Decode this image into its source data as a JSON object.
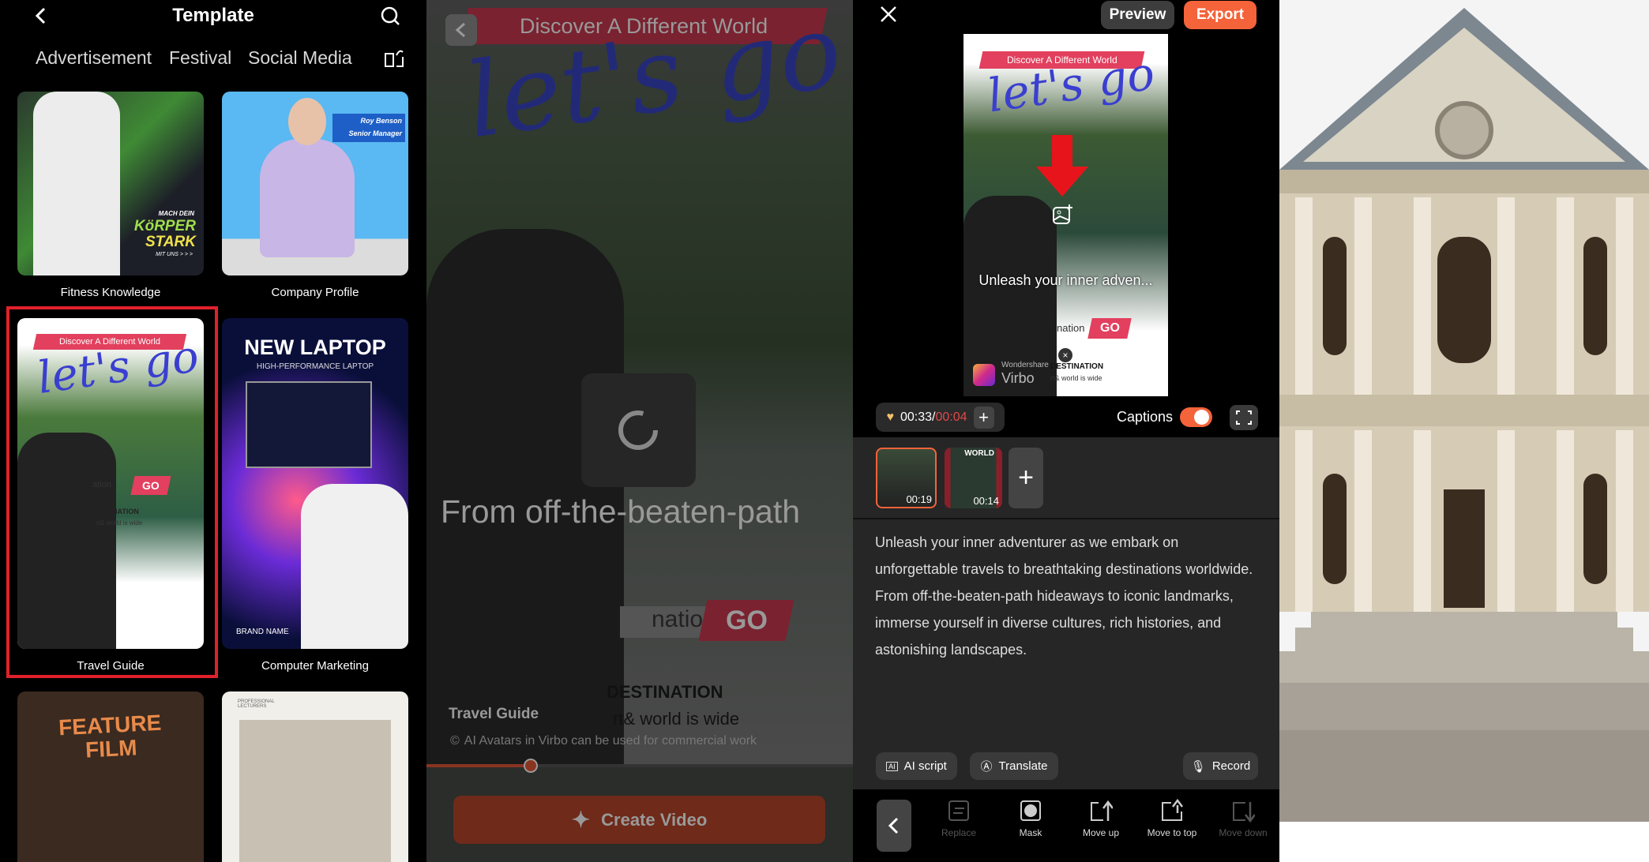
{
  "template_panel": {
    "title": "Template",
    "tabs": [
      "Advertisement",
      "Festival",
      "Social Media"
    ],
    "cards": [
      {
        "label": "Fitness Knowledge",
        "overlay": [
          "MACH DEIN",
          "KöRPER",
          "STARK",
          "MIT UNS > > >"
        ]
      },
      {
        "label": "Company Profile",
        "overlay": [
          "Roy Benson",
          "Senior Manager"
        ]
      },
      {
        "label": "Travel Guide",
        "overlay": [
          "Discover A Different World",
          "let's go",
          "ation",
          "GO",
          "ESTINATION",
          "rt& world is wide"
        ],
        "selected": true
      },
      {
        "label": "Computer Marketing",
        "overlay": [
          "NEW LAPTOP",
          "HIGH-PERFORMANCE LAPTOP",
          "BRAND NAME"
        ]
      },
      {
        "label": "",
        "overlay": [
          "FEATURE",
          "FILM"
        ]
      },
      {
        "label": "",
        "overlay": [
          "PROFESSIONAL LECTURERS"
        ]
      }
    ],
    "selection_color": "#e0212b"
  },
  "preview_panel": {
    "banner": "Discover A Different World",
    "script_title": "let's go",
    "subtitle": "From off-the-beaten-path",
    "cta_left": "nation",
    "cta_right": "GO",
    "destination": "DESTINATION",
    "tagline": "rt& world is wide",
    "template_name": "Travel Guide",
    "notice": "AI Avatars in Virbo can be used for commercial work",
    "progress_percent": 24,
    "create_button": "Create Video"
  },
  "editor_panel": {
    "preview_button": "Preview",
    "export_button": "Export",
    "accent": "#f4633a",
    "canvas": {
      "banner": "Discover A Different World",
      "script_title": "let's go",
      "caption": "Unleash your inner adven...",
      "cta_left": "nation",
      "cta_right": "GO",
      "destination": "DESTINATION",
      "tagline": "rt& world is wide",
      "watermark_brand": "Wondershare",
      "watermark_name": "Virbo"
    },
    "time_used": "00:33",
    "time_limit": "00:04",
    "captions_label": "Captions",
    "captions_on": true,
    "clips": [
      {
        "duration": "00:19",
        "selected": true
      },
      {
        "duration": "00:14",
        "tag": "WORLD"
      }
    ],
    "script": "Unleash your inner adventurer as we embark on unforgettable travels to breathtaking destinations worldwide. From off-the-beaten-path hideaways to iconic landmarks, immerse yourself in diverse cultures, rich histories, and astonishing landscapes.",
    "actions": {
      "ai_script": "AI script",
      "translate": "Translate",
      "record": "Record"
    },
    "tools": [
      {
        "label": "Replace",
        "enabled": false
      },
      {
        "label": "Mask",
        "enabled": true
      },
      {
        "label": "Move up",
        "enabled": true
      },
      {
        "label": "Move to top",
        "enabled": true
      },
      {
        "label": "Move down",
        "enabled": false
      }
    ]
  }
}
